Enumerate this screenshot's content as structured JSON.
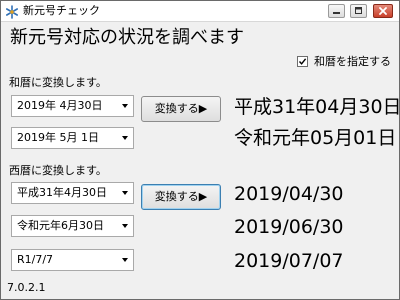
{
  "window": {
    "title": "新元号チェック"
  },
  "heading": "新元号対応の状況を調べます",
  "specify_wareki": {
    "label": "和暦を指定する",
    "checked": true
  },
  "to_wareki": {
    "section_label": "和暦に変換します。",
    "inputs": [
      "2019年  4月30日",
      "2019年  5月  1日"
    ],
    "button_label": "変換する▶",
    "results": [
      "平成31年04月30日",
      "令和元年05月01日"
    ]
  },
  "to_seireki": {
    "section_label": "西暦に変換します。",
    "inputs": [
      "平成31年4月30日",
      "令和元年6月30日",
      "R1/7/7"
    ],
    "button_label": "変換する▶",
    "results": [
      "2019/04/30",
      "2019/06/30",
      "2019/07/07"
    ]
  },
  "version": "7.0.2.1",
  "icons": {
    "app": "app-snowflake-icon",
    "minimize": "minimize-icon",
    "maximize": "maximize-icon",
    "close": "close-icon",
    "check": "check-icon",
    "dropdown": "chevron-down-icon"
  },
  "colors": {
    "close_button": "#c8402a",
    "focus_border": "#3c7fb1",
    "window_bg": "#f0f0f0"
  }
}
